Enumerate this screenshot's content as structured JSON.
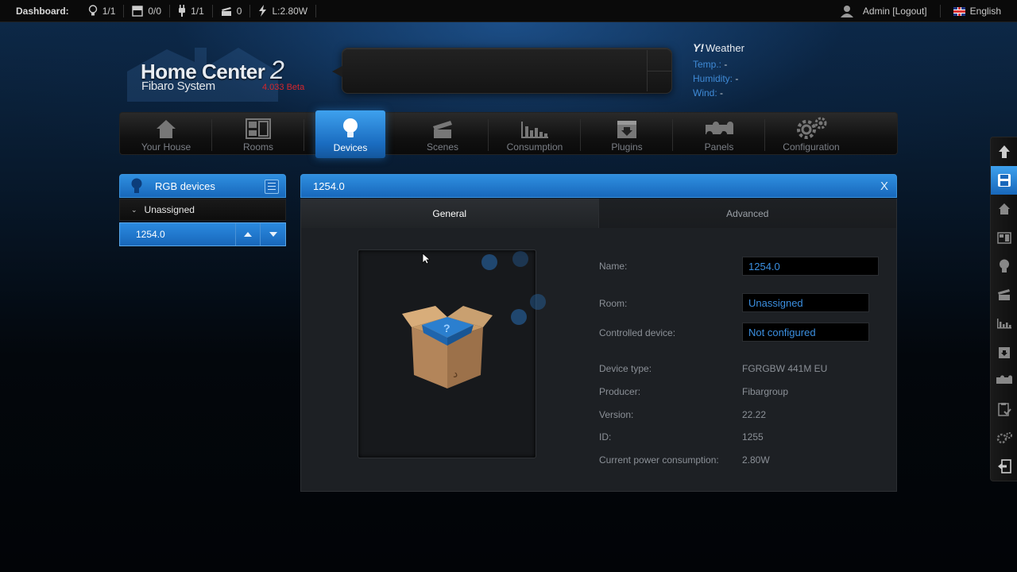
{
  "topbar": {
    "dashboard_label": "Dashboard:",
    "stats": [
      {
        "icon": "bulb-icon",
        "value": "1/1"
      },
      {
        "icon": "blind-icon",
        "value": "0/0"
      },
      {
        "icon": "plug-icon",
        "value": "1/1"
      },
      {
        "icon": "scene-icon",
        "value": "0"
      },
      {
        "icon": "power-icon",
        "value": "L:2.80W"
      }
    ],
    "user": "Admin [Logout]",
    "language": "English"
  },
  "logo": {
    "title": "Home Center",
    "title_num": "2",
    "subtitle": "Fibaro System",
    "version": "4.033 Beta"
  },
  "weather": {
    "brand": "Y!",
    "title": "Weather",
    "temp_label": "Temp.:",
    "temp_value": "-",
    "humidity_label": "Humidity:",
    "humidity_value": "-",
    "wind_label": "Wind:",
    "wind_value": "-"
  },
  "nav": [
    {
      "label": "Your House",
      "icon": "house-icon"
    },
    {
      "label": "Rooms",
      "icon": "rooms-icon"
    },
    {
      "label": "Devices",
      "icon": "bulb-icon"
    },
    {
      "label": "Scenes",
      "icon": "clapper-icon"
    },
    {
      "label": "Consumption",
      "icon": "chart-icon"
    },
    {
      "label": "Plugins",
      "icon": "plugin-box-icon"
    },
    {
      "label": "Panels",
      "icon": "puzzle-icon"
    },
    {
      "label": "Configuration",
      "icon": "gears-icon"
    }
  ],
  "left_panel": {
    "header": "RGB devices",
    "group": "Unassigned",
    "item": "1254.0"
  },
  "main_panel": {
    "title": "1254.0",
    "close": "X",
    "tabs": [
      "General",
      "Advanced"
    ],
    "fields": {
      "name_label": "Name:",
      "name_value": "1254.0",
      "room_label": "Room:",
      "room_value": "Unassigned",
      "controlled_label": "Controlled device:",
      "controlled_value": "Not configured",
      "type_label": "Device type:",
      "type_value": "FGRGBW 441M EU",
      "producer_label": "Producer:",
      "producer_value": "Fibargroup",
      "version_label": "Version:",
      "version_value": "22.22",
      "id_label": "ID:",
      "id_value": "1255",
      "power_label": "Current power consumption:",
      "power_value": "2.80W"
    }
  },
  "colors": {
    "accent": "#1f7ad0",
    "link": "#3b8fe0",
    "version_red": "#d6262c"
  }
}
